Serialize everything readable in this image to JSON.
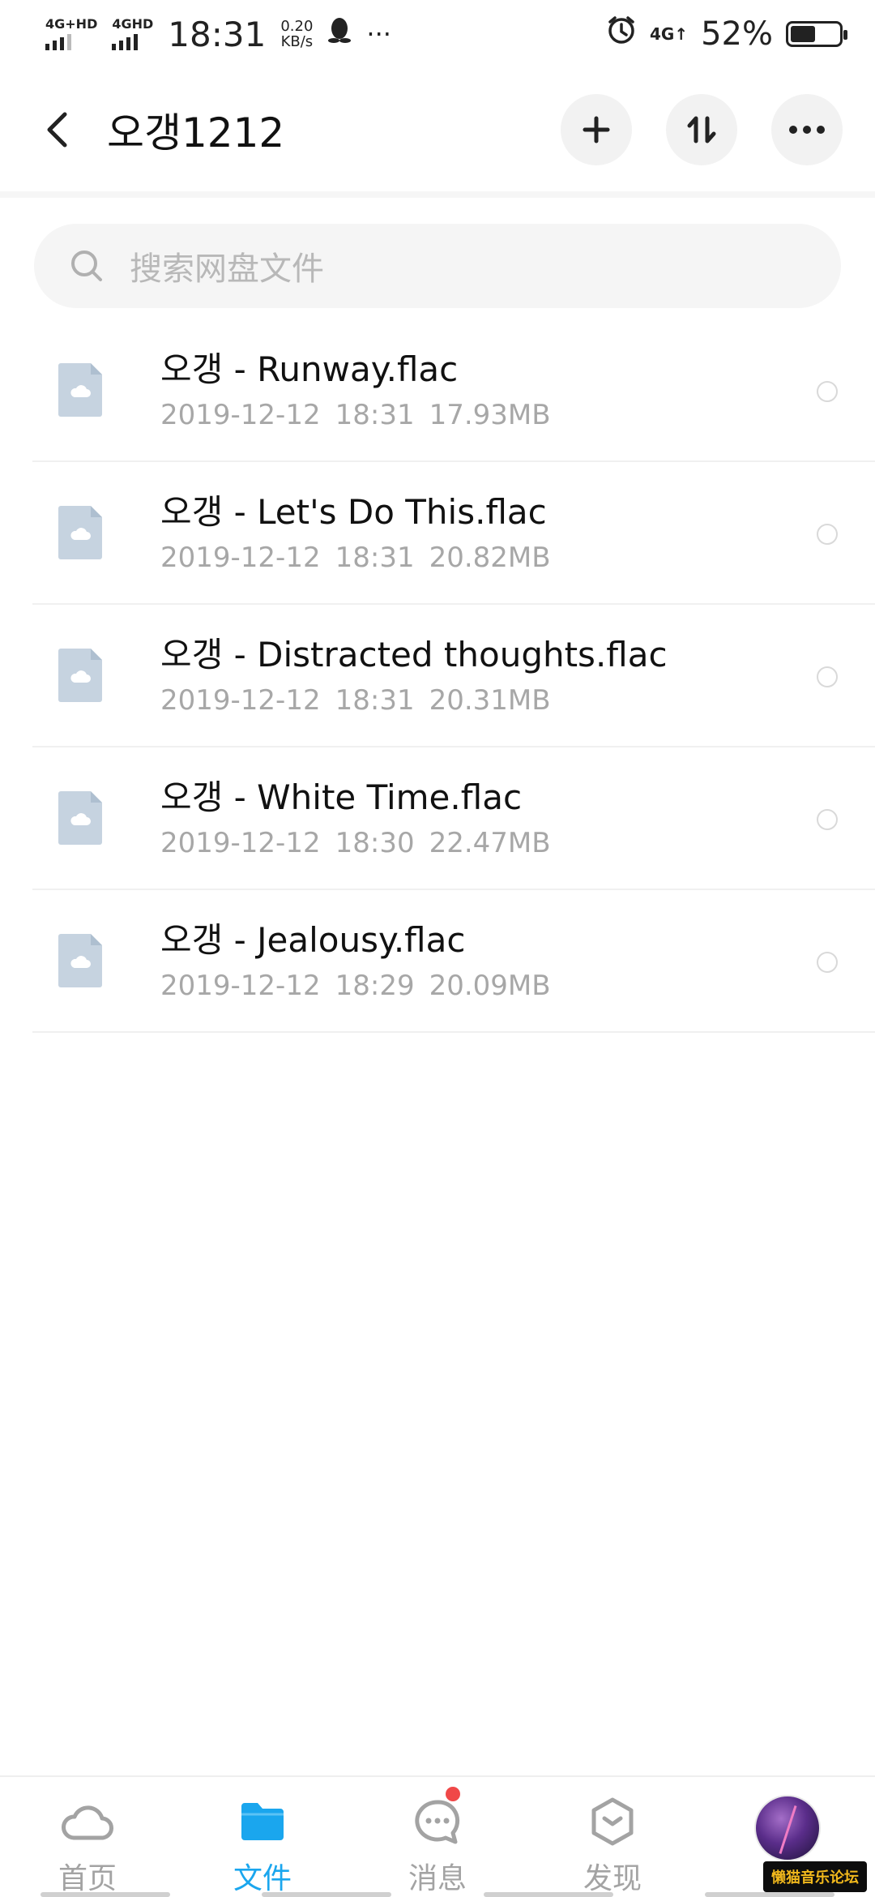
{
  "status_bar": {
    "sim1_label": "4G+HD",
    "sim2_label": "4GHD",
    "time": "18:31",
    "net_speed_value": "0.20",
    "net_speed_unit": "KB/s",
    "more": "···",
    "data_label": "4G↑",
    "battery_percent": "52%",
    "battery_level": 0.52,
    "icons": [
      "signal-icon",
      "qq-icon",
      "alarm-icon",
      "battery-icon"
    ]
  },
  "header": {
    "title": "오갱1212",
    "back_icon": "chevron-left-icon",
    "actions": [
      "add-icon",
      "sort-icon",
      "more-icon"
    ]
  },
  "search": {
    "placeholder": "搜索网盘文件",
    "icon": "search-icon"
  },
  "files": [
    {
      "name": "오갱 - Runway.flac",
      "date": "2019-12-12",
      "time": "18:31",
      "size": "17.93MB"
    },
    {
      "name": "오갱 - Let's Do This.flac",
      "date": "2019-12-12",
      "time": "18:31",
      "size": "20.82MB"
    },
    {
      "name": "오갱 - Distracted thoughts.flac",
      "date": "2019-12-12",
      "time": "18:31",
      "size": "20.31MB"
    },
    {
      "name": "오갱 - White Time.flac",
      "date": "2019-12-12",
      "time": "18:30",
      "size": "22.47MB"
    },
    {
      "name": "오갱 - Jealousy.flac",
      "date": "2019-12-12",
      "time": "18:29",
      "size": "20.09MB"
    }
  ],
  "bottom_nav": {
    "items": [
      {
        "label": "首页",
        "icon": "cloud-icon",
        "active": false
      },
      {
        "label": "文件",
        "icon": "folder-icon",
        "active": true
      },
      {
        "label": "消息",
        "icon": "chat-bubble-icon",
        "active": false,
        "badge": true
      },
      {
        "label": "发现",
        "icon": "discover-icon",
        "active": false
      },
      {
        "label": "",
        "icon": "avatar",
        "active": false
      }
    ],
    "accent_color": "#1aa6ee",
    "inactive_color": "#a3a3a3"
  },
  "watermark": "懒猫音乐论坛"
}
